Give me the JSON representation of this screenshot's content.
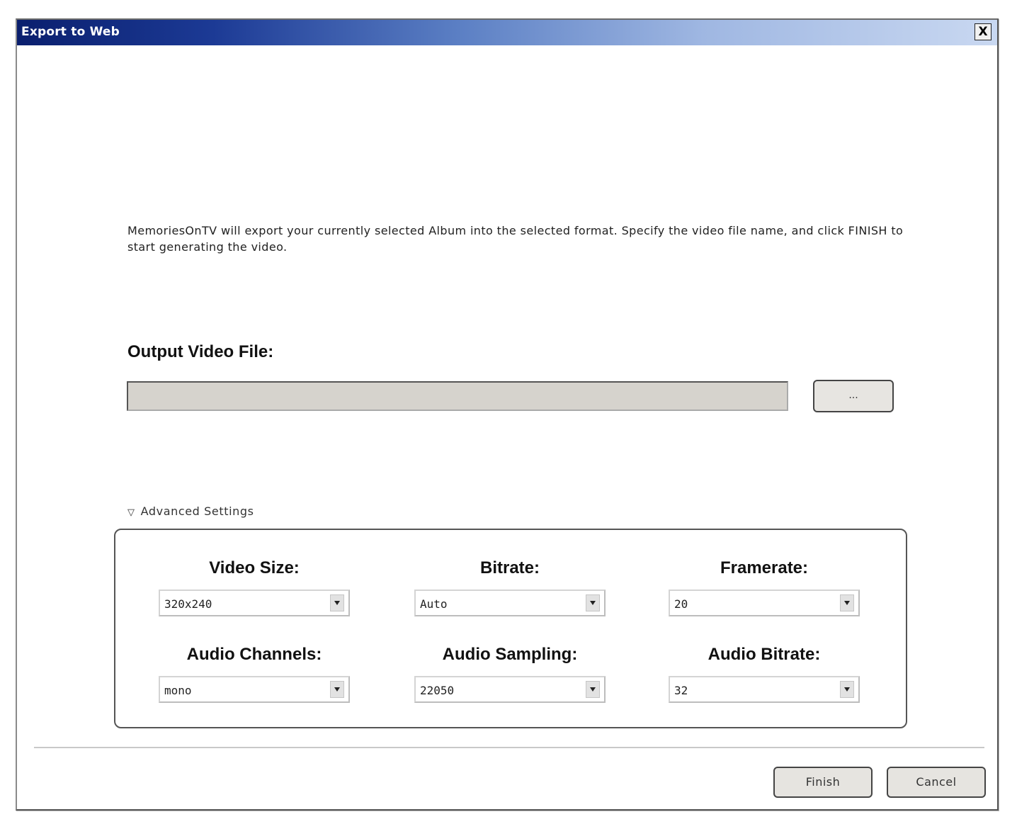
{
  "window": {
    "title": "Export to Web",
    "close_label": "X"
  },
  "description": "MemoriesOnTV will export your currently selected Album into the selected format. Specify the video file name, and click FINISH to start generating the video.",
  "output": {
    "label": "Output Video File:",
    "value": "",
    "browse_label": "..."
  },
  "advanced": {
    "toggle_label": "Advanced Settings",
    "toggle_icon": "triangle-down-icon",
    "settings": [
      {
        "label": "Video Size:",
        "value": "320x240"
      },
      {
        "label": "Bitrate:",
        "value": "Auto"
      },
      {
        "label": "Framerate:",
        "value": "20"
      },
      {
        "label": "Audio Channels:",
        "value": "mono"
      },
      {
        "label": "Audio Sampling:",
        "value": "22050"
      },
      {
        "label": "Audio Bitrate:",
        "value": "32"
      }
    ]
  },
  "footer": {
    "finish_label": "Finish",
    "cancel_label": "Cancel"
  },
  "colors": {
    "titlebar_start": "#0a1f6e",
    "titlebar_end": "#c9d8f1",
    "input_bg": "#d6d3cd",
    "button_bg": "#e6e4e0"
  }
}
